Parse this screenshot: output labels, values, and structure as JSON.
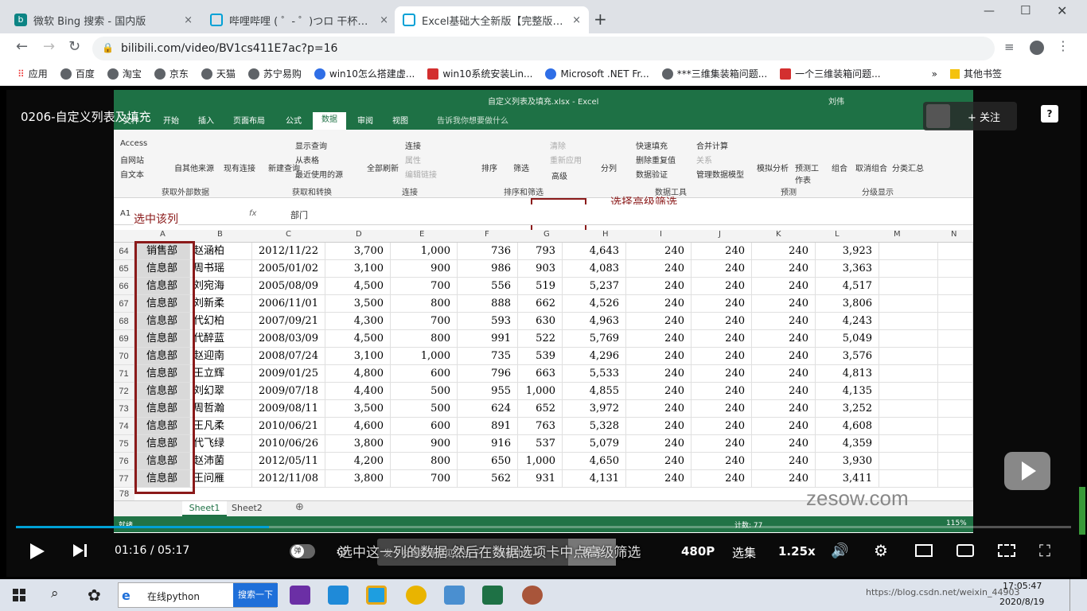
{
  "tabs": [
    {
      "title": "微软 Bing 搜索 - 国内版",
      "close": "×"
    },
    {
      "title": "哔哩哔哩 ( ゜- ゜)つロ 干杯~-bilibili",
      "close": "×"
    },
    {
      "title": "Excel基础大全新版【完整版】_哔哩哔哩",
      "close": "×"
    }
  ],
  "new_tab": "+",
  "window_controls": {
    "min": "—",
    "max": "☐",
    "close": "✕"
  },
  "url": "bilibili.com/video/BV1cs411E7ac?p=16",
  "bookmarks": [
    "应用",
    "百度",
    "淘宝",
    "京东",
    "天猫",
    "苏宁易购",
    "win10怎么搭建虚...",
    "win10系统安装Lin...",
    "Microsoft .NET Fr...",
    "***三维集装箱问题...",
    "一个三维装箱问题..."
  ],
  "bookmarks_more": "»",
  "other_bookmarks": "其他书签",
  "video": {
    "title": "0206-自定义列表及填充",
    "follow": "+ 关注",
    "help": "?",
    "time_current": "01:16",
    "time_sep": "/",
    "time_total": "05:17",
    "danmaku_toggle": "弹",
    "danmaku_placeholder": "发个友善的弹幕见证当下",
    "danmaku_etiquette": "弹幕礼仪 >",
    "send": "发送",
    "quality": "480P",
    "episodes": "选集",
    "speed": "1.25x",
    "subtitle": "选中这一列的数据 然后在数据选项卡中点高级筛选",
    "watermark": "zesow.com",
    "progress_ratio": 0.24
  },
  "excel": {
    "window_title": "自定义列表及填充.xlsx - Excel",
    "user": "刘伟",
    "ribbon_tabs": [
      "文件",
      "开始",
      "插入",
      "页面布局",
      "公式",
      "数据",
      "审阅",
      "视图"
    ],
    "active_tab": "数据",
    "tell_me": "告诉我你想要做什么",
    "groups": {
      "get_external": {
        "label": "获取外部数据",
        "items": [
          "Access",
          "自网站",
          "自文本",
          "自其他来源",
          "现有连接"
        ]
      },
      "get_transform": {
        "label": "获取和转换",
        "items": [
          "新建查询",
          "显示查询",
          "从表格",
          "最近使用的源"
        ]
      },
      "connections": {
        "label": "连接",
        "items": [
          "全部刷新",
          "连接",
          "属性",
          "编辑链接"
        ]
      },
      "sort_filter": {
        "label": "排序和筛选",
        "items": [
          "排序",
          "筛选",
          "清除",
          "重新应用",
          "高级"
        ]
      },
      "data_tools": {
        "label": "数据工具",
        "items": [
          "分列",
          "快速填充",
          "删除重复值",
          "数据验证",
          "合并计算",
          "关系",
          "管理数据模型"
        ]
      },
      "forecast": {
        "label": "预测",
        "items": [
          "模拟分析",
          "预测工作表"
        ]
      },
      "outline": {
        "label": "分级显示",
        "items": [
          "组合",
          "取消组合",
          "分类汇总"
        ]
      }
    },
    "cell_ref": "A1",
    "formula": "部门",
    "fx": "fx",
    "annotation_select_col": "选中该列",
    "annotation_advanced": "选择高级筛选",
    "columns": [
      "A",
      "B",
      "C",
      "D",
      "E",
      "F",
      "G",
      "H",
      "I",
      "J",
      "K",
      "L",
      "M",
      "N"
    ],
    "rows": [
      [
        "64",
        "销售部",
        "赵涵柏",
        "2012/11/22",
        "3,700",
        "1,000",
        "736",
        "793",
        "4,643",
        "240",
        "240",
        "240",
        "3,923"
      ],
      [
        "65",
        "信息部",
        "周书瑶",
        "2005/01/02",
        "3,100",
        "900",
        "986",
        "903",
        "4,083",
        "240",
        "240",
        "240",
        "3,363"
      ],
      [
        "66",
        "信息部",
        "刘宛海",
        "2005/08/09",
        "4,500",
        "700",
        "556",
        "519",
        "5,237",
        "240",
        "240",
        "240",
        "4,517"
      ],
      [
        "67",
        "信息部",
        "刘新柔",
        "2006/11/01",
        "3,500",
        "800",
        "888",
        "662",
        "4,526",
        "240",
        "240",
        "240",
        "3,806"
      ],
      [
        "68",
        "信息部",
        "代幻柏",
        "2007/09/21",
        "4,300",
        "700",
        "593",
        "630",
        "4,963",
        "240",
        "240",
        "240",
        "4,243"
      ],
      [
        "69",
        "信息部",
        "代醉蓝",
        "2008/03/09",
        "4,500",
        "800",
        "991",
        "522",
        "5,769",
        "240",
        "240",
        "240",
        "5,049"
      ],
      [
        "70",
        "信息部",
        "赵迎南",
        "2008/07/24",
        "3,100",
        "1,000",
        "735",
        "539",
        "4,296",
        "240",
        "240",
        "240",
        "3,576"
      ],
      [
        "71",
        "信息部",
        "王立辉",
        "2009/01/25",
        "4,800",
        "600",
        "796",
        "663",
        "5,533",
        "240",
        "240",
        "240",
        "4,813"
      ],
      [
        "72",
        "信息部",
        "刘幻翠",
        "2009/07/18",
        "4,400",
        "500",
        "955",
        "1,000",
        "4,855",
        "240",
        "240",
        "240",
        "4,135"
      ],
      [
        "73",
        "信息部",
        "周哲瀚",
        "2009/08/11",
        "3,500",
        "500",
        "624",
        "652",
        "3,972",
        "240",
        "240",
        "240",
        "3,252"
      ],
      [
        "74",
        "信息部",
        "王凡柔",
        "2010/06/21",
        "4,600",
        "600",
        "891",
        "763",
        "5,328",
        "240",
        "240",
        "240",
        "4,608"
      ],
      [
        "75",
        "信息部",
        "代飞绿",
        "2010/06/26",
        "3,800",
        "900",
        "916",
        "537",
        "5,079",
        "240",
        "240",
        "240",
        "4,359"
      ],
      [
        "76",
        "信息部",
        "赵沛菌",
        "2012/05/11",
        "4,200",
        "800",
        "650",
        "1,000",
        "4,650",
        "240",
        "240",
        "240",
        "3,930"
      ],
      [
        "77",
        "信息部",
        "王问雁",
        "2012/11/08",
        "3,800",
        "700",
        "562",
        "931",
        "4,131",
        "240",
        "240",
        "240",
        "3,411"
      ]
    ],
    "last_row": "78",
    "sheets": [
      "Sheet1",
      "Sheet2"
    ],
    "status_ready": "就绪",
    "status_count": "计数: 77",
    "zoom": "115%"
  },
  "taskbar": {
    "search_text": "在线python",
    "search_button": "搜索一下",
    "url_overlay": "https://blog.csdn.net/weixin_44903",
    "time": "17:05:47",
    "date": "2020/8/19"
  }
}
